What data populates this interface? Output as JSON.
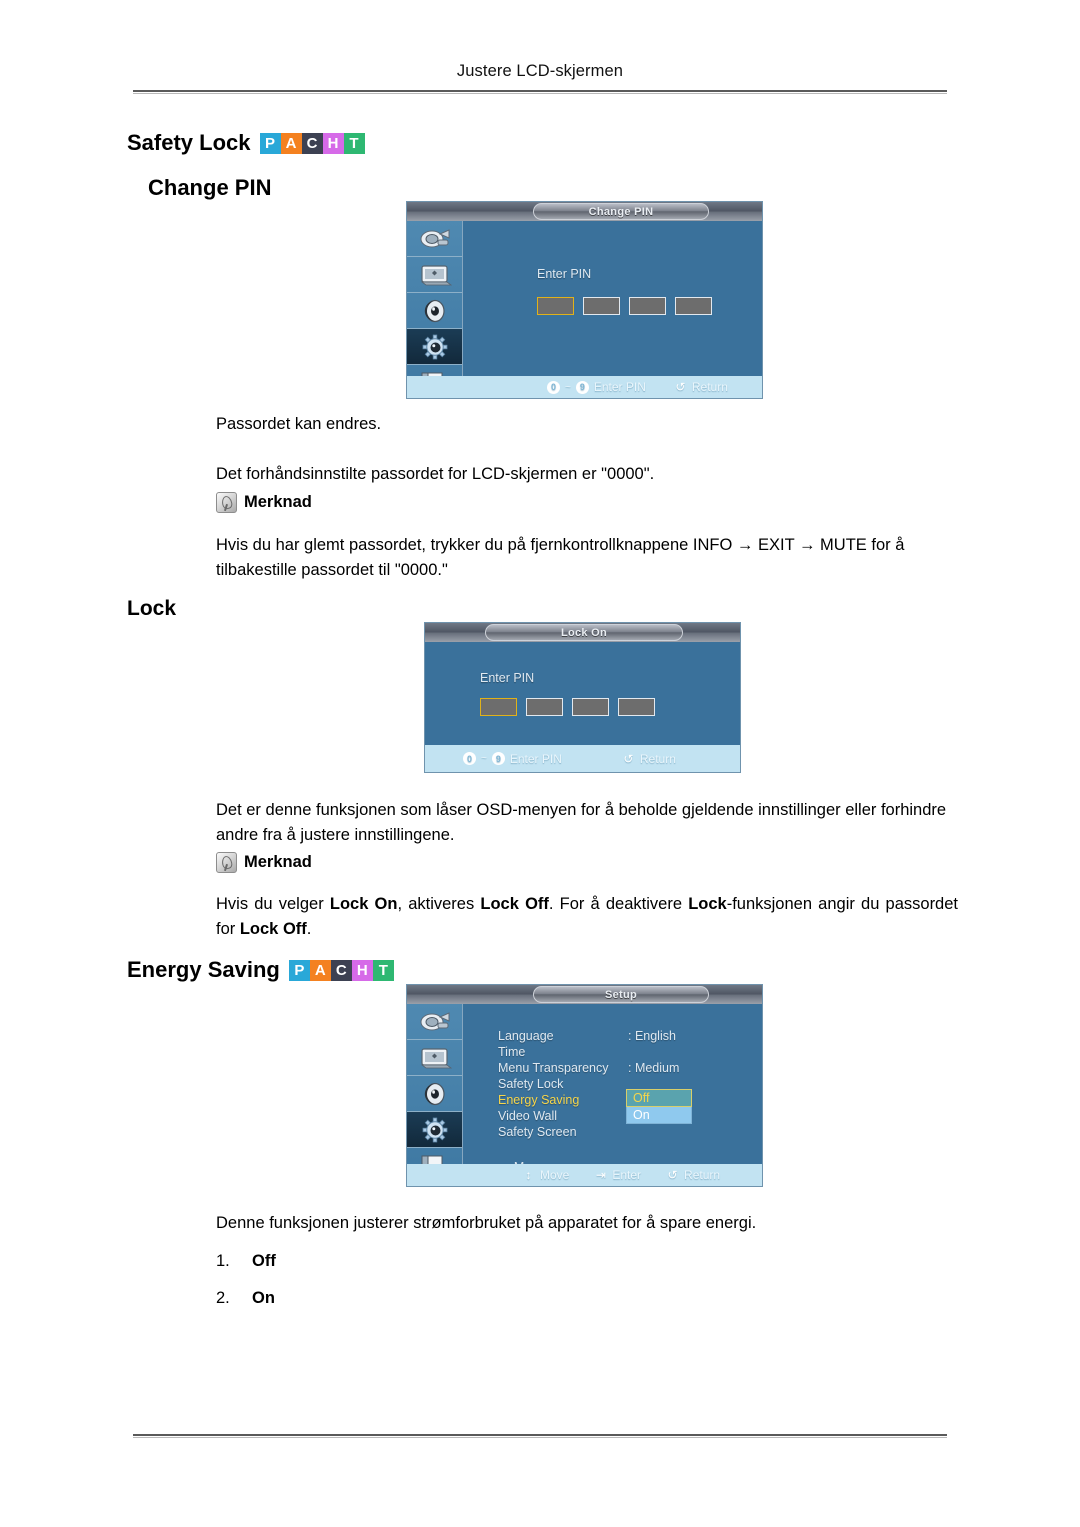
{
  "page": {
    "running_head": "Justere LCD-skjermen"
  },
  "badge": {
    "letters": [
      {
        "ch": "P",
        "color": "#29a8d8"
      },
      {
        "ch": "A",
        "color": "#f48120"
      },
      {
        "ch": "C",
        "color": "#3d4152"
      },
      {
        "ch": "H",
        "color": "#d66ae8"
      },
      {
        "ch": "T",
        "color": "#2eb872"
      }
    ]
  },
  "sections": {
    "safety_lock": {
      "heading": "Safety Lock",
      "sub_heading": "Change PIN",
      "paragraph_1": "Passordet kan endres.",
      "paragraph_2": "Det forhåndsinnstilte passordet for LCD-skjermen er \"0000\".",
      "note_label": "Merknad",
      "note_body": "Hvis du har glemt passordet, trykker du på fjernkontrollknappene INFO → EXIT → MUTE for å tilbakestille passordet til \"0000.\""
    },
    "lock": {
      "heading": "Lock",
      "paragraph_1": "Det er denne funksjonen som låser OSD-menyen for å beholde gjeldende innstillinger eller forhindre andre fra å justere innstillingene.",
      "note_label": "Merknad",
      "note_body_parts": [
        {
          "t": "Hvis du velger ",
          "b": false
        },
        {
          "t": "Lock On",
          "b": true
        },
        {
          "t": ", aktiveres ",
          "b": false
        },
        {
          "t": "Lock Off",
          "b": true
        },
        {
          "t": ". For å deaktivere ",
          "b": false
        },
        {
          "t": "Lock",
          "b": true
        },
        {
          "t": "-funksjonen angir du passordet for ",
          "b": false
        },
        {
          "t": "Lock Off",
          "b": true
        },
        {
          "t": ".",
          "b": false
        }
      ]
    },
    "energy_saving": {
      "heading": "Energy Saving",
      "paragraph_1": "Denne funksjonen justerer strømforbruket på apparatet for å spare energi.",
      "options": [
        {
          "num": "1.",
          "label": "Off"
        },
        {
          "num": "2.",
          "label": "On"
        }
      ]
    }
  },
  "osd_change_pin": {
    "title": "Change PIN",
    "enter_pin_label": "Enter PIN",
    "pin_boxes": [
      "",
      "",
      "",
      ""
    ],
    "bottom": {
      "key_from": "0",
      "key_sep": "~",
      "key_to": "9",
      "action_label": "Enter PIN",
      "return_label": "Return",
      "return_icon": "return-arrow-icon"
    },
    "sidebar_icons": [
      "input-source-icon",
      "picture-icon",
      "sound-speaker-icon",
      "setup-gear-icon",
      "multi-control-icon"
    ],
    "active_sidebar_index": 3
  },
  "osd_lock_on": {
    "title": "Lock On",
    "enter_pin_label": "Enter PIN",
    "pin_boxes": [
      "",
      "",
      "",
      ""
    ],
    "bottom": {
      "key_from": "0",
      "key_sep": "~",
      "key_to": "9",
      "action_label": "Enter PIN",
      "return_label": "Return",
      "return_icon": "return-arrow-icon"
    }
  },
  "osd_setup": {
    "title": "Setup",
    "menu": [
      {
        "name": "Language",
        "value": ": English",
        "highlight": false
      },
      {
        "name": "Time",
        "value": "",
        "highlight": false
      },
      {
        "name": "Menu Transparency",
        "value": ": Medium",
        "highlight": false
      },
      {
        "name": "Safety Lock",
        "value": "",
        "highlight": false
      },
      {
        "name": "Energy Saving",
        "value": ":",
        "highlight": true
      },
      {
        "name": "Video Wall",
        "value": "",
        "highlight": false
      },
      {
        "name": "Safety Screen",
        "value": "",
        "highlight": false
      }
    ],
    "more_label": "More",
    "dropdown": {
      "selected": "Off",
      "other": "On"
    },
    "bottom": {
      "move_label": "Move",
      "enter_label": "Enter",
      "return_label": "Return"
    },
    "sidebar_icons": [
      "input-source-icon",
      "picture-icon",
      "sound-speaker-icon",
      "setup-gear-icon",
      "multi-control-icon"
    ],
    "active_sidebar_index": 3
  }
}
